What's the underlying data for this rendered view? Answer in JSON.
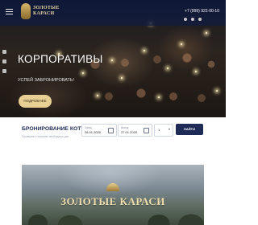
{
  "header": {
    "logo_text": "ЗОЛОТЫЕ КАРАСИ",
    "phone": "+7 (999) 922-00-10"
  },
  "hero": {
    "title": "КОРПОРАТИВЫ",
    "subtitle": "УСПЕЙ ЗАБРОНИРОВАТЬ!",
    "button_label": "ПОДРОБНЕЕ"
  },
  "booking": {
    "title": "БРОНИРОВАНИЕ КОТТЕДЖЕЙ",
    "subtitle": "Проверьте наличие свободных дат",
    "checkin_caption": "Заезд",
    "checkin_value": "26.01.2020",
    "checkout_caption": "Выезд",
    "checkout_value": "27.01.2020",
    "guests_value": "1",
    "find_button": "НАЙТИ КОТТЕДЖ"
  },
  "video": {
    "logo_text": "ЗОЛОТЫЕ КАРАСИ"
  }
}
